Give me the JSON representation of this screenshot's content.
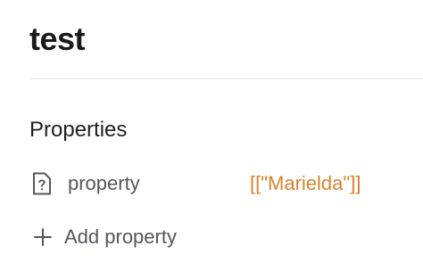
{
  "document": {
    "title": "test"
  },
  "properties": {
    "heading": "Properties",
    "items": [
      {
        "icon": "question-file-icon",
        "name": "property",
        "value": "[[\"Marielda\"]]"
      }
    ],
    "add_label": "Add property",
    "add_icon": "plus-icon"
  },
  "colors": {
    "value_accent": "#d9822b",
    "muted_text": "#55555e",
    "divider": "#e4e4e7"
  }
}
